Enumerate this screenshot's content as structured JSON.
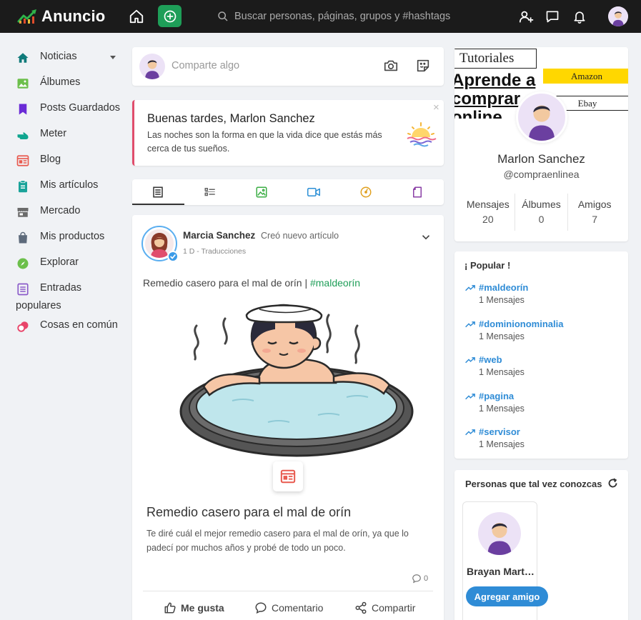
{
  "app": {
    "name": "Anuncio",
    "search_placeholder": "Buscar personas, páginas, grupos y #hashtags"
  },
  "sidebar": {
    "items": [
      {
        "label": "Noticias",
        "icon": "home-icon",
        "color": "#0f7a7a"
      },
      {
        "label": "Álbumes",
        "icon": "image-icon",
        "color": "#6cbf4b"
      },
      {
        "label": "Posts Guardados",
        "icon": "bookmark-icon",
        "color": "#6a2bd6"
      },
      {
        "label": "Meter",
        "icon": "poke-hand-icon",
        "color": "#0fa58f"
      },
      {
        "label": "Blog",
        "icon": "blog-icon",
        "color": "#e85a4f"
      },
      {
        "label": "Mis artículos",
        "icon": "clipboard-icon",
        "color": "#1aa39a"
      },
      {
        "label": "Mercado",
        "icon": "store-icon",
        "color": "#6b6b6b"
      },
      {
        "label": "Mis productos",
        "icon": "bag-icon",
        "color": "#5d6a7b"
      },
      {
        "label": "Explorar",
        "icon": "compass-icon",
        "color": "#6cbf4b"
      },
      {
        "label": "Entradas populares",
        "icon": "list-icon",
        "color": "#8a5bc9"
      },
      {
        "label": "Cosas en común",
        "icon": "common-things-icon",
        "color": "#e8456a"
      }
    ]
  },
  "share": {
    "placeholder": "Comparte algo"
  },
  "greeting": {
    "title": "Buenas tardes, Marlon Sanchez",
    "message": "Las noches son la forma en que la vida dice que estás más cerca de tus sueños.",
    "close": "×"
  },
  "post": {
    "author": "Marcia Sanchez",
    "action": "Creó nuevo artículo",
    "meta": "1 D - Traducciones",
    "text": "Remedio casero para el mal de orín | ",
    "hashtag": "#maldeorín",
    "article_title": "Remedio casero para el mal de orín",
    "article_desc": "Te diré cuál el mejor remedio casero para el mal de orín, ya que lo padecí por muchos años y probé de todo un poco.",
    "comment_count": "0",
    "like_label": "Me gusta",
    "comment_label": "Comentario",
    "share_label": "Compartir"
  },
  "profile": {
    "cover": {
      "tutoriales": "Tutoriales",
      "amazon": "Amazon",
      "ebay": "Ebay",
      "big_text": "Aprende a comprar online"
    },
    "name": "Marlon Sanchez",
    "username": "@compraenlinea",
    "stats": [
      {
        "label": "Mensajes",
        "value": "20"
      },
      {
        "label": "Álbumes",
        "value": "0"
      },
      {
        "label": "Amigos",
        "value": "7"
      }
    ]
  },
  "popular": {
    "title": "¡ Popular !",
    "items": [
      {
        "tag": "#maldeorín",
        "count": "1 Mensajes"
      },
      {
        "tag": "#dominionominalia",
        "count": "1 Mensajes"
      },
      {
        "tag": "#web",
        "count": "1 Mensajes"
      },
      {
        "tag": "#pagina",
        "count": "1 Mensajes"
      },
      {
        "tag": "#servisor",
        "count": "1 Mensajes"
      }
    ]
  },
  "people": {
    "title": "Personas que tal vez conozcas",
    "suggestion": {
      "name": "Brayan Martinez",
      "button": "Agregar amigo"
    }
  },
  "colors": {
    "topbar": "#1b1b1b",
    "accent_green": "#1e9e58",
    "link_blue": "#2f8cd6",
    "greeting_border": "#e04d6c"
  }
}
